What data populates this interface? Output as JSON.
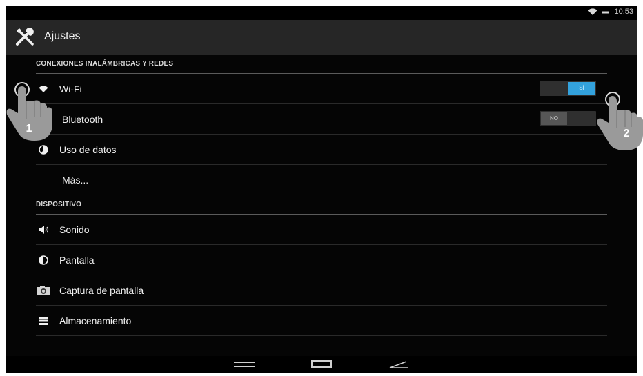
{
  "status_bar": {
    "time": "10:53"
  },
  "action_bar": {
    "title": "Ajustes"
  },
  "sections": {
    "wireless": {
      "header": "CONEXIONES INALÁMBRICAS Y REDES"
    },
    "device": {
      "header": "DISPOSITIVO"
    }
  },
  "items": {
    "wifi": {
      "label": "Wi-Fi",
      "toggle": "SÍ",
      "state": "on"
    },
    "bluetooth": {
      "label": "Bluetooth",
      "toggle": "NO",
      "state": "off"
    },
    "data_usage": {
      "label": "Uso de datos"
    },
    "more": {
      "label": "Más..."
    },
    "sound": {
      "label": "Sonido"
    },
    "display": {
      "label": "Pantalla"
    },
    "screenshot": {
      "label": "Captura de pantalla"
    },
    "storage": {
      "label": "Almacenamiento"
    }
  },
  "callouts": {
    "first": "1",
    "second": "2"
  },
  "colors": {
    "accent": "#33a2dd",
    "background": "#050505",
    "action_bar": "#262626"
  }
}
